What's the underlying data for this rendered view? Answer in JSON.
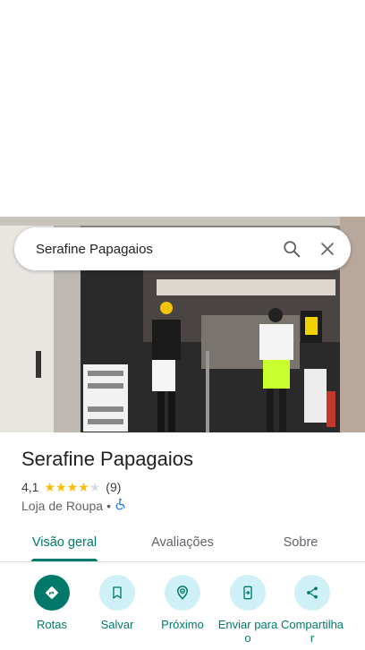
{
  "search": {
    "query": "Serafine Papagaios"
  },
  "place": {
    "name": "Serafine Papagaios",
    "rating": "4,1",
    "stars": 4.1,
    "review_count": "(9)",
    "category": "Loja de Roupa",
    "separator": "•",
    "accessibility_icon": "wheelchair-icon"
  },
  "tabs": [
    {
      "label": "Visão geral",
      "active": true
    },
    {
      "label": "Avaliações",
      "active": false
    },
    {
      "label": "Sobre",
      "active": false
    }
  ],
  "actions": [
    {
      "label": "Rotas",
      "icon": "directions-icon"
    },
    {
      "label": "Salvar",
      "icon": "bookmark-icon"
    },
    {
      "label": "Próximo",
      "icon": "nearby-icon"
    },
    {
      "label": "Enviar para o",
      "icon": "send-to-phone-icon"
    },
    {
      "label": "Compartilhar",
      "icon": "share-icon"
    }
  ],
  "colors": {
    "accent": "#00796b",
    "action_bg": "#cff0f7",
    "star": "#fbbc04"
  }
}
